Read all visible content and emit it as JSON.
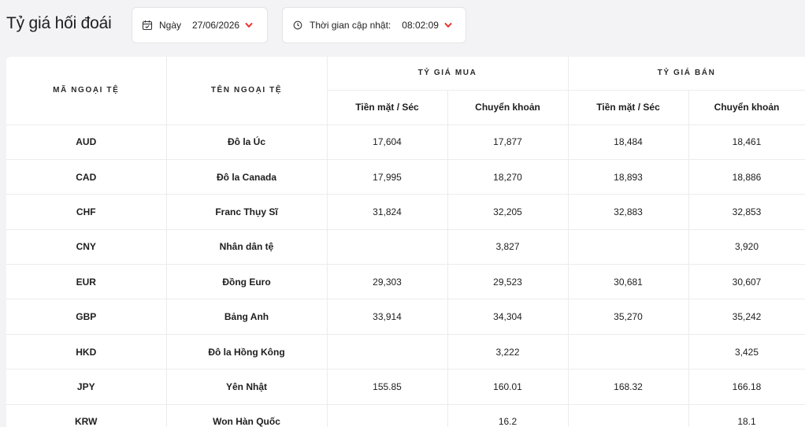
{
  "header": {
    "title": "Tỷ giá hối đoái",
    "date_label": "Ngày",
    "date_value": "27/06/2026",
    "time_label": "Thời gian cập nhật:",
    "time_value": "08:02:09"
  },
  "colors": {
    "accent": "#e8322a"
  },
  "icons": {
    "date": "calendar-icon",
    "time": "clock-icon",
    "dropdown": "chevron-down-icon"
  },
  "table": {
    "col_code": "MÃ NGOẠI TỆ",
    "col_name": "TÊN NGOẠI TỆ",
    "group_buy": "TỶ GIÁ MUA",
    "group_sell": "TỶ GIÁ BÁN",
    "sub_cash": "Tiền mặt / Séc",
    "sub_transfer": "Chuyển khoản",
    "rows": [
      {
        "code": "AUD",
        "name": "Đô la Úc",
        "buy_cash": "17,604",
        "buy_transfer": "17,877",
        "sell_cash": "18,484",
        "sell_transfer": "18,461"
      },
      {
        "code": "CAD",
        "name": "Đô la Canada",
        "buy_cash": "17,995",
        "buy_transfer": "18,270",
        "sell_cash": "18,893",
        "sell_transfer": "18,886"
      },
      {
        "code": "CHF",
        "name": "Franc Thụy Sĩ",
        "buy_cash": "31,824",
        "buy_transfer": "32,205",
        "sell_cash": "32,883",
        "sell_transfer": "32,853"
      },
      {
        "code": "CNY",
        "name": "Nhân dân tệ",
        "buy_cash": "",
        "buy_transfer": "3,827",
        "sell_cash": "",
        "sell_transfer": "3,920"
      },
      {
        "code": "EUR",
        "name": "Đồng Euro",
        "buy_cash": "29,303",
        "buy_transfer": "29,523",
        "sell_cash": "30,681",
        "sell_transfer": "30,607"
      },
      {
        "code": "GBP",
        "name": "Bảng Anh",
        "buy_cash": "33,914",
        "buy_transfer": "34,304",
        "sell_cash": "35,270",
        "sell_transfer": "35,242"
      },
      {
        "code": "HKD",
        "name": "Đô la Hồng Kông",
        "buy_cash": "",
        "buy_transfer": "3,222",
        "sell_cash": "",
        "sell_transfer": "3,425"
      },
      {
        "code": "JPY",
        "name": "Yên Nhật",
        "buy_cash": "155.85",
        "buy_transfer": "160.01",
        "sell_cash": "168.32",
        "sell_transfer": "166.18"
      },
      {
        "code": "KRW",
        "name": "Won Hàn Quốc",
        "buy_cash": "",
        "buy_transfer": "16.2",
        "sell_cash": "",
        "sell_transfer": "18.1"
      }
    ]
  }
}
